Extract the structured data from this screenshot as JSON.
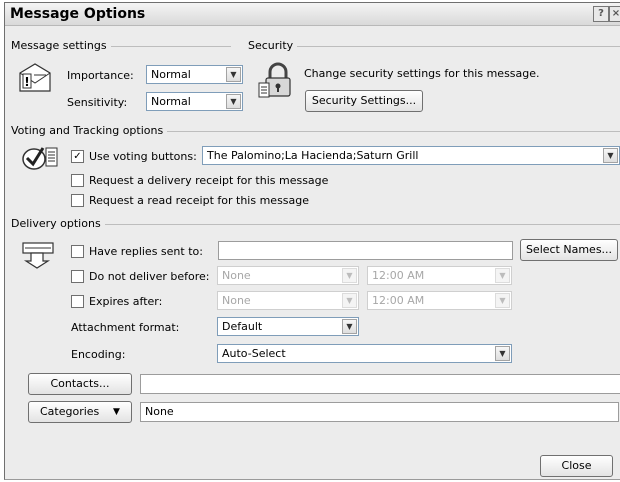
{
  "window": {
    "title": "Message Options"
  },
  "message_settings": {
    "group_label": "Message settings",
    "importance_label": "Importance:",
    "importance_value": "Normal",
    "sensitivity_label": "Sensitivity:",
    "sensitivity_value": "Normal"
  },
  "security": {
    "group_label": "Security",
    "text": "Change security settings for this message.",
    "button_label": "Security Settings..."
  },
  "voting": {
    "group_label": "Voting and Tracking options",
    "use_voting_label": "Use voting buttons:",
    "use_voting_checked": true,
    "voting_value": "The Palomino;La Hacienda;Saturn Grill",
    "delivery_receipt_label": "Request a delivery receipt for this message",
    "read_receipt_label": "Request a read receipt for this message"
  },
  "delivery": {
    "group_label": "Delivery options",
    "have_replies_label": "Have replies sent to:",
    "select_names_label": "Select Names...",
    "do_not_deliver_label": "Do not deliver before:",
    "do_not_deliver_date": "None",
    "do_not_deliver_time": "12:00 AM",
    "expires_label": "Expires after:",
    "expires_date": "None",
    "expires_time": "12:00 AM",
    "attachment_format_label": "Attachment format:",
    "attachment_format_value": "Default",
    "encoding_label": "Encoding:",
    "encoding_value": "Auto-Select"
  },
  "contacts": {
    "button_label": "Contacts...",
    "value": ""
  },
  "categories": {
    "button_label": "Categories",
    "value": "None"
  },
  "close_button_label": "Close"
}
